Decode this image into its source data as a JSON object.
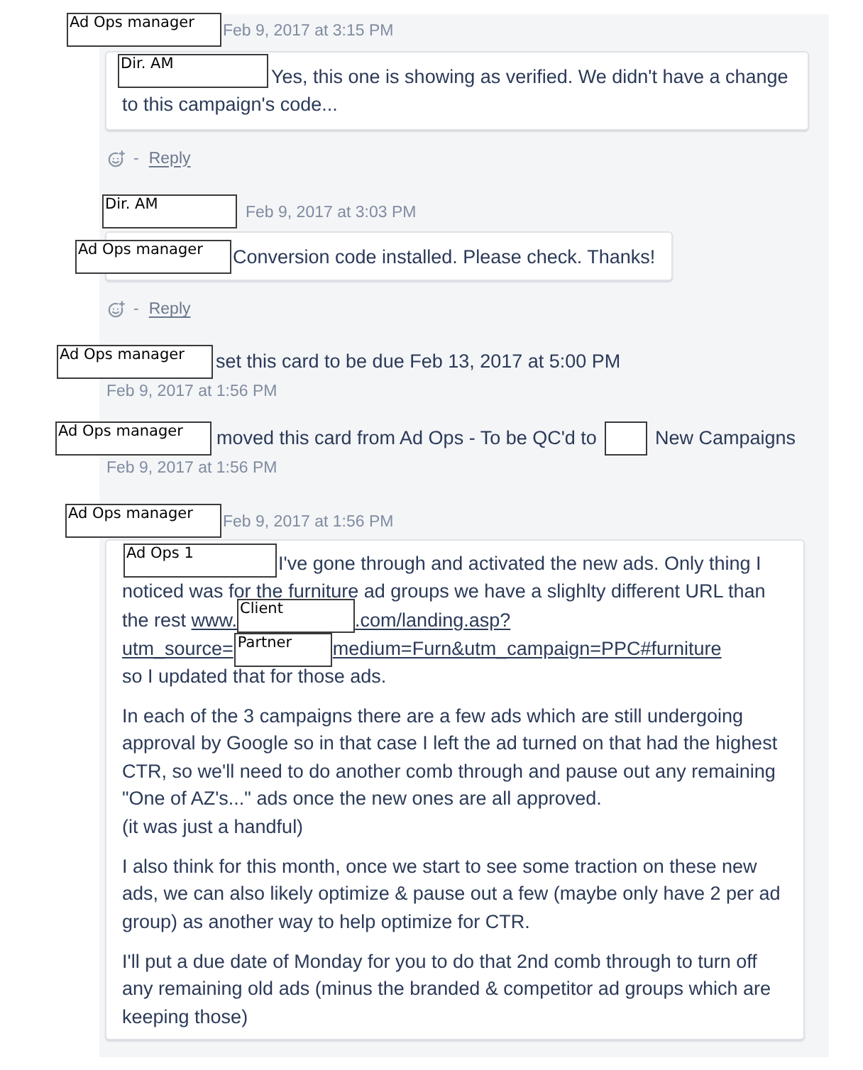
{
  "activity": [
    {
      "kind": "comment",
      "author": {
        "kind": "redaction",
        "label": "Ad Ops manager"
      },
      "time": "Feb 9, 2017 at 3:15 PM",
      "paragraphs": [
        [
          {
            "kind": "redaction",
            "label": "Dir. AM"
          },
          {
            "kind": "text",
            "text": "Yes, this one is showing as verified. We didn't have a change to this campaign's code..."
          }
        ]
      ],
      "separator": "-",
      "reply": "Reply"
    },
    {
      "kind": "comment",
      "author": {
        "kind": "redaction",
        "label": "Dir. AM"
      },
      "time": "Feb 9, 2017 at 3:03 PM",
      "paragraphs": [
        [
          {
            "kind": "redaction",
            "label": "Ad Ops manager"
          },
          {
            "kind": "text",
            "text": "Conversion code installed. Please check. Thanks!"
          }
        ]
      ],
      "separator": "-",
      "reply": "Reply"
    },
    {
      "kind": "action",
      "parts": [
        {
          "kind": "redaction",
          "label": "Ad Ops manager"
        },
        {
          "kind": "text",
          "text": "set this card to be due Feb 13, 2017 at 5:00 PM"
        }
      ],
      "time": "Feb 9, 2017 at 1:56 PM"
    },
    {
      "kind": "action",
      "parts": [
        {
          "kind": "redaction",
          "label": "Ad Ops manager"
        },
        {
          "kind": "text",
          "text": "moved this card from Ad Ops - To be QC'd to"
        },
        {
          "kind": "redaction"
        },
        {
          "kind": "text",
          "text": "New Campaigns"
        }
      ],
      "time": "Feb 9, 2017 at 1:56 PM"
    },
    {
      "kind": "comment",
      "author": {
        "kind": "redaction",
        "label": "Ad Ops manager"
      },
      "time": "Feb 9, 2017 at 1:56 PM",
      "paragraphs": [
        [
          {
            "kind": "redaction",
            "label": "Ad Ops 1"
          },
          {
            "kind": "text",
            "text": "I've gone through and activated the new ads. Only thing I noticed was for the furniture ad groups we have a slighlty different URL than the rest "
          },
          {
            "kind": "link",
            "parts": [
              {
                "kind": "text",
                "text": "www."
              },
              {
                "kind": "redaction",
                "label": "Client"
              },
              {
                "kind": "text",
                "text": ".com/landing.asp?"
              },
              {
                "kind": "break"
              },
              {
                "kind": "text",
                "text": "utm_source="
              },
              {
                "kind": "redaction",
                "label": "Partner"
              },
              {
                "kind": "text",
                "text": "medium=Furn&utm_campaign=PPC#furniture"
              }
            ]
          },
          {
            "kind": "break"
          },
          {
            "kind": "text",
            "text": "so I updated that for those ads."
          }
        ],
        [
          {
            "kind": "text",
            "text": "In each of the 3 campaigns there are a few ads which are still undergoing approval by Google so in that case I left the ad turned on that had the highest CTR, so we'll need to do another comb through and pause out any remaining \"One of AZ's...\" ads once the new ones are all approved."
          },
          {
            "kind": "break"
          },
          {
            "kind": "text",
            "text": "(it was just a handful)"
          }
        ],
        [
          {
            "kind": "text",
            "text": "I also think for this month, once we start to see some traction on these new ads, we can also likely optimize & pause out a few (maybe only have 2 per ad group) as another way to help optimize for CTR."
          }
        ],
        [
          {
            "kind": "text",
            "text": "I'll put a due date of Monday for you to do that 2nd comb through to turn off any remaining old ads (minus the branded & competitor ad groups which are keeping those)"
          }
        ]
      ]
    }
  ]
}
